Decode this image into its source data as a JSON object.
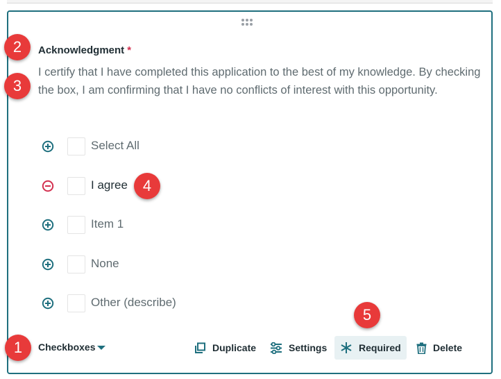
{
  "question": {
    "title": "Acknowledgment",
    "required_marker": "*",
    "description": "I certify that I have completed this application to the best of my knowledge. By checking the box, I am confirming that I have no conflicts of interest with this opportunity."
  },
  "options": [
    {
      "label": "Select All",
      "toggle": "plus-circle-icon"
    },
    {
      "label": "I agree",
      "toggle": "minus-circle-icon"
    },
    {
      "label": "Item 1",
      "toggle": "plus-circle-icon"
    },
    {
      "label": "None",
      "toggle": "plus-circle-icon"
    },
    {
      "label": "Other (describe)",
      "toggle": "plus-circle-icon"
    }
  ],
  "footer": {
    "type_label": "Checkboxes",
    "duplicate": "Duplicate",
    "settings": "Settings",
    "required": "Required",
    "delete": "Delete"
  },
  "badges": [
    "1",
    "2",
    "3",
    "4",
    "5"
  ],
  "colors": {
    "accent": "#1e6f7e",
    "required_star": "#d32f4f",
    "badge": "#e83a3a",
    "active_bg": "#e8f1f3"
  }
}
